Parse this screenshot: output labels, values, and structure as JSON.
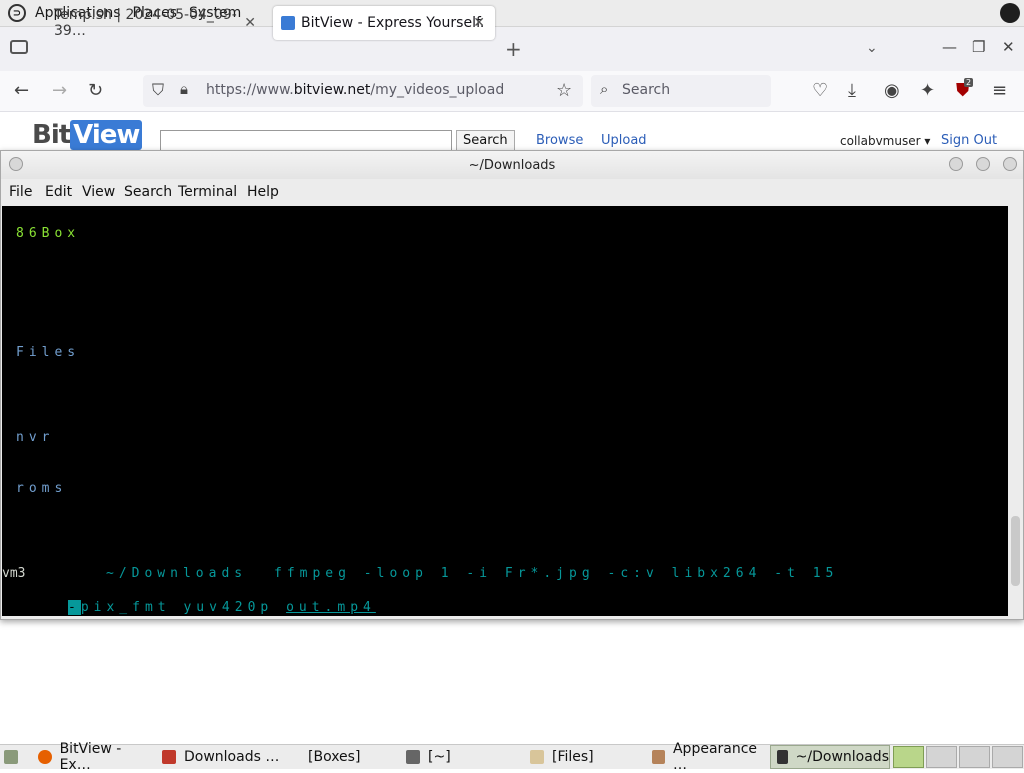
{
  "top_panel": {
    "menus": [
      "Applications",
      "Places",
      "System"
    ],
    "logo_icon": "gnome-foot-icon",
    "tray_icon": "obs-icon"
  },
  "browser": {
    "tabs": [
      {
        "label": "Temp.sh | 2024-05-04_09-39…",
        "active": false
      },
      {
        "label": "BitView - Express Yourself.",
        "active": true
      }
    ],
    "url_prefix": "https://www.",
    "url_domain": "bitview.net",
    "url_path": "/my_videos_upload",
    "search_placeholder": "Search",
    "extension_badge": "2"
  },
  "page": {
    "logo_text": "Bit",
    "logo_text_v": "View",
    "search_button": "Search",
    "links": [
      "Browse",
      "Upload"
    ],
    "user": "collabvmuser ▾",
    "sign_out": "Sign Out"
  },
  "terminal": {
    "title": "~/Downloads",
    "menus": [
      "File",
      "Edit",
      "View",
      "Search",
      "Terminal",
      "Help"
    ],
    "entries": [
      {
        "name": "86Box"
      },
      {
        "name": "Files"
      },
      {
        "name": "nvr"
      },
      {
        "name": "roms"
      }
    ],
    "prompt_host": "vm3",
    "prompt_path": "~/Downloads",
    "command_line1": "ffmpeg -loop 1 -i Fr*.jpg -c:v libx264 -t 15",
    "command_line2_cursor": "-",
    "command_line2_mid": "pix_fmt yuv420p ",
    "command_line2_end": "out.mp4"
  },
  "taskbar": {
    "items": [
      {
        "label": "BitView - Ex…",
        "icon": "firefox-icon"
      },
      {
        "label": "Downloads …",
        "icon": "file-manager-icon"
      },
      {
        "label": "[Boxes]",
        "icon": "boxes-icon"
      },
      {
        "label": "[~]",
        "icon": "terminal-icon"
      },
      {
        "label": "[Files]",
        "icon": "folder-icon"
      },
      {
        "label": "Appearance …",
        "icon": "appearance-icon"
      },
      {
        "label": "~/Downloads",
        "icon": "terminal-icon"
      }
    ]
  }
}
